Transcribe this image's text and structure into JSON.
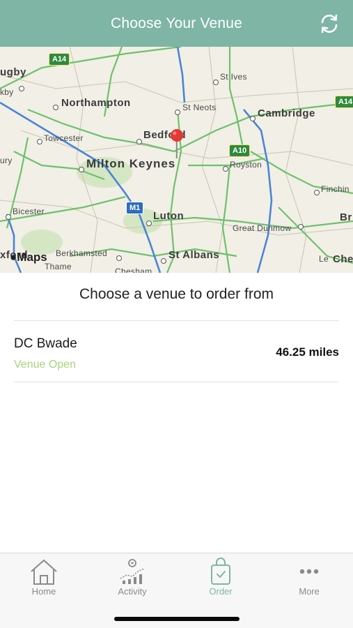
{
  "header": {
    "title": "Choose Your Venue",
    "refresh_icon": "refresh-icon"
  },
  "map": {
    "labels": {
      "rugby": "ugby",
      "rugby_b": "kby",
      "northampton": "Northampton",
      "st_ives": "St Ives",
      "st_neots": "St Neots",
      "cambridge": "Cambridge",
      "towcester": "Towcester",
      "bedford": "Bedford",
      "milton_keynes": "Milton Keynes",
      "royston": "Royston",
      "bury": "ury",
      "finchingfield": "Finchin",
      "bicester": "Bicester",
      "luton": "Luton",
      "great_dunmow": "Great Dunmow",
      "br": "Br",
      "oxford": "xford",
      "berkhamsted": "Berkhamsted",
      "st_albans": "St Albans",
      "thame": "Thame",
      "chesham": "Chesham",
      "chelmsford": "Chel",
      "le": "Le"
    },
    "road_badges": {
      "a14_left": "A14",
      "a14_right": "A14",
      "a10": "A10",
      "m1": "M1"
    },
    "attribution": "Maps"
  },
  "list": {
    "subtitle": "Choose a venue to order from",
    "venues": [
      {
        "name": "DC Bwade",
        "status": "Venue Open",
        "distance": "46.25 miles"
      }
    ]
  },
  "tabbar": {
    "tabs": [
      {
        "label": "Home",
        "icon": "home-icon"
      },
      {
        "label": "Activity",
        "icon": "activity-icon"
      },
      {
        "label": "Order",
        "icon": "shopping-bag-icon",
        "active": true
      },
      {
        "label": "More",
        "icon": "more-dots-icon"
      }
    ]
  },
  "colors": {
    "accent": "#7fb5a4",
    "open_status": "#a7d47c",
    "pin": "#e53935"
  }
}
